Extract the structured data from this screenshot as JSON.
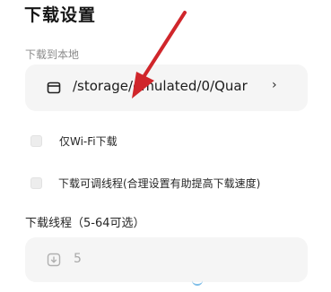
{
  "page": {
    "title": "下载设置"
  },
  "local_download": {
    "section_label": "下载到本地",
    "folder_icon": "folder-icon",
    "path": "/storage/emulated/0/Quar",
    "chevron": "›"
  },
  "options": {
    "wifi_only_label": "仅Wi-Fi下载",
    "adjustable_threads_label": "下载可调线程(合理设置有助提高下载速度)"
  },
  "threads": {
    "label": "下载线程（5-64可选）",
    "icon": "download-icon",
    "value": "5"
  },
  "colors": {
    "annotation_arrow": "#d0262b",
    "card_background": "#f5f5f5",
    "muted_text": "#8a8a8a"
  }
}
